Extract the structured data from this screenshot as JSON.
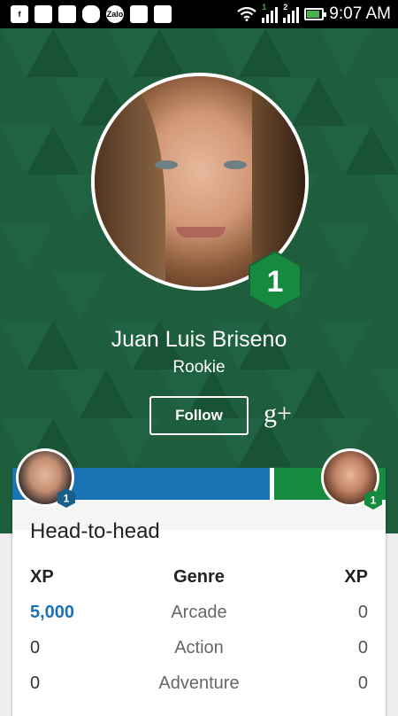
{
  "status_bar": {
    "time": "9:07 AM",
    "network_labels": [
      "1",
      "2"
    ],
    "app_icons": [
      "facebook-icon",
      "sd-card-icon",
      "gallery-icon",
      "gamepad-icon",
      "zalo-icon",
      "briefcase-check-icon",
      "briefcase-upload-icon"
    ],
    "zalo_label": "Zalo"
  },
  "profile": {
    "name": "Juan Luis Briseno",
    "rank": "Rookie",
    "level": "1",
    "follow_label": "Follow",
    "gplus_label": "g+"
  },
  "head_to_head": {
    "title": "Head-to-head",
    "left_level": "1",
    "right_level": "1",
    "columns": {
      "left_xp": "XP",
      "genre": "Genre",
      "right_xp": "XP"
    },
    "rows": [
      {
        "left_xp": "5,000",
        "genre": "Arcade",
        "right_xp": "0"
      },
      {
        "left_xp": "0",
        "genre": "Action",
        "right_xp": "0"
      },
      {
        "left_xp": "0",
        "genre": "Adventure",
        "right_xp": "0"
      }
    ]
  },
  "colors": {
    "header_green": "#1e5e3d",
    "badge_green": "#168a3f",
    "badge_blue": "#1a5e8a",
    "bar_blue": "#1a73b5",
    "bar_green": "#168a3f"
  }
}
